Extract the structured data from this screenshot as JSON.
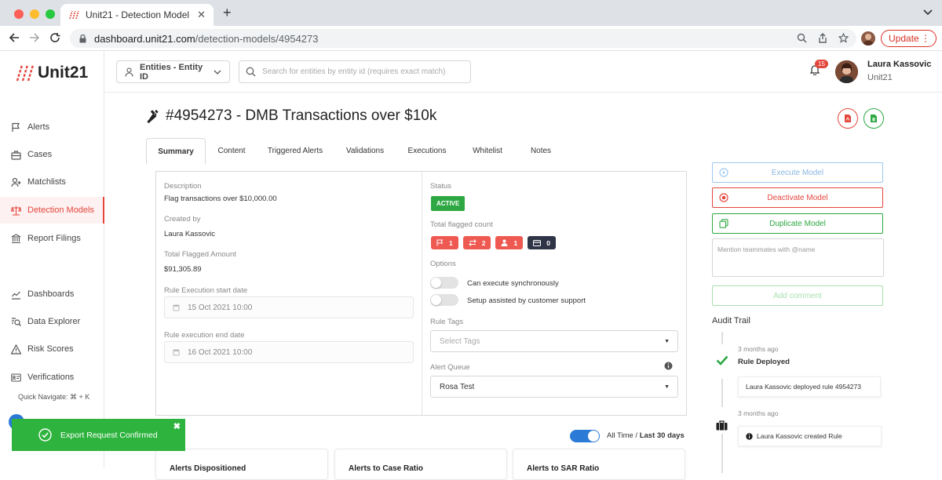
{
  "browser": {
    "tab_title": "Unit21 - Detection Model",
    "url_host": "dashboard.unit21.com",
    "url_path": "/detection-models/4954273",
    "update_label": "Update"
  },
  "sidebar": {
    "logo_text": "Unit21",
    "brand_color": "#e4463c",
    "items": [
      {
        "label": "Alerts",
        "icon": "flag-icon"
      },
      {
        "label": "Cases",
        "icon": "briefcase-icon"
      },
      {
        "label": "Matchlists",
        "icon": "user-plus-icon"
      },
      {
        "label": "Detection Models",
        "icon": "scale-icon",
        "active": true
      },
      {
        "label": "Report Filings",
        "icon": "bank-icon"
      },
      {
        "label": "Dashboards",
        "icon": "chart-line-icon"
      },
      {
        "label": "Data Explorer",
        "icon": "search-list-icon"
      },
      {
        "label": "Risk Scores",
        "icon": "warning-icon"
      },
      {
        "label": "Verifications",
        "icon": "id-card-icon"
      }
    ],
    "quick_navigate": "Quick Navigate: ⌘ + K"
  },
  "topbar": {
    "entity_dropdown": "Entities - Entity ID",
    "search_placeholder": "Search for entities by entity id (requires exact match)",
    "notification_count": "15",
    "user_name": "Laura Kassovic",
    "user_org": "Unit21"
  },
  "page": {
    "title": "#4954273 - DMB Transactions over $10k",
    "tabs": [
      "Summary",
      "Content",
      "Triggered Alerts",
      "Validations",
      "Executions",
      "Whitelist",
      "Notes"
    ],
    "active_tab": "Summary"
  },
  "summary": {
    "description_label": "Description",
    "description_value": "Flag transactions over $10,000.00",
    "created_by_label": "Created by",
    "created_by_value": "Laura Kassovic",
    "total_flagged_amount_label": "Total Flagged Amount",
    "total_flagged_amount_value": "$91,305.89",
    "start_date_label": "Rule Execution start date",
    "start_date_value": "15 Oct 2021 10:00",
    "end_date_label": "Rule execution end date",
    "end_date_value": "16 Oct 2021 10:00",
    "status_label": "Status",
    "status_value": "ACTIVE",
    "status_color": "#2ea843",
    "flagged_count_label": "Total flagged count",
    "flagged_counts": [
      {
        "icon": "flag-icon",
        "value": "1",
        "color": "#ee5a52"
      },
      {
        "icon": "transfer-icon",
        "value": "2",
        "color": "#ee5a52"
      },
      {
        "icon": "user-icon",
        "value": "1",
        "color": "#ee5a52"
      },
      {
        "icon": "card-icon",
        "value": "0",
        "color": "#2f3447"
      }
    ],
    "options_label": "Options",
    "option_sync": "Can execute synchronously",
    "option_support": "Setup assisted by customer support",
    "rule_tags_label": "Rule Tags",
    "rule_tags_placeholder": "Select Tags",
    "alert_queue_label": "Alert Queue",
    "alert_queue_value": "Rosa Test"
  },
  "actions": {
    "execute": "Execute Model",
    "deactivate": "Deactivate Model",
    "duplicate": "Duplicate Model",
    "mention_placeholder": "Mention teammates with @name",
    "add_comment": "Add comment"
  },
  "audit": {
    "title": "Audit Trail",
    "entries": [
      {
        "time": "3 months ago",
        "event": "Rule Deployed",
        "detail": "Laura Kassovic deployed rule 4954273"
      },
      {
        "time": "3 months ago",
        "event": "",
        "detail": "Laura Kassovic created Rule"
      }
    ]
  },
  "stats": {
    "range_all": "All Time /",
    "range_last": "Last 30 days",
    "cards": [
      "Alerts Dispositioned",
      "Alerts to Case Ratio",
      "Alerts to SAR Ratio"
    ]
  },
  "toast": {
    "message": "Export Request Confirmed"
  }
}
